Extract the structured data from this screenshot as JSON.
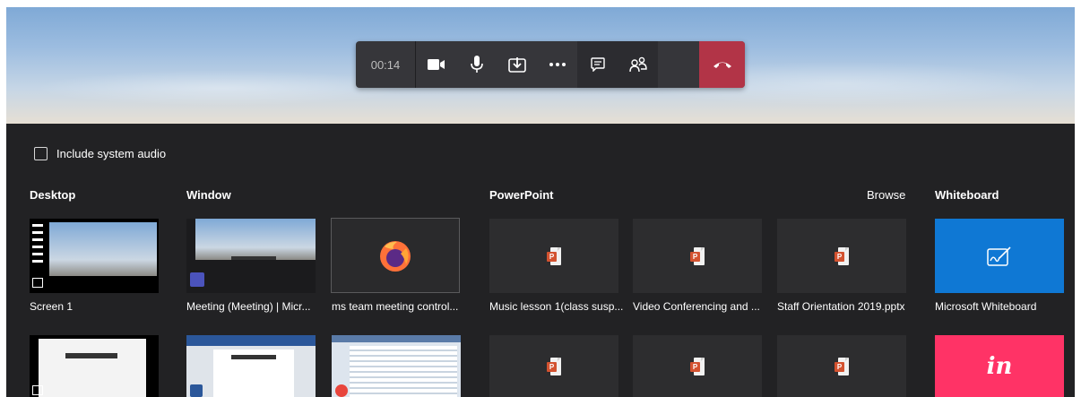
{
  "controls": {
    "timer": "00:14",
    "icons": [
      "video-camera-icon",
      "microphone-icon",
      "share-tray-icon",
      "more-options-icon",
      "chat-icon",
      "participants-icon",
      "hang-up-icon"
    ]
  },
  "tray": {
    "include_audio_label": "Include system audio",
    "sections": {
      "desktop": "Desktop",
      "window": "Window",
      "powerpoint": "PowerPoint",
      "browse": "Browse",
      "whiteboard": "Whiteboard"
    },
    "row1": {
      "screen": "Screen 1",
      "window1": "Meeting (Meeting) | Micr...",
      "window2": "ms team meeting control...",
      "ppt1": "Music lesson 1(class susp...",
      "ppt2": "Video Conferencing and ...",
      "ppt3": "Staff Orientation 2019.pptx",
      "whiteboard": "Microsoft Whiteboard"
    },
    "invision_text": "in"
  },
  "colors": {
    "tray_bg": "#222224",
    "controls_bg": "#36363a",
    "hangup": "#b23447",
    "whiteboard_blue": "#0f78d4",
    "invision_pink": "#ff3366",
    "ppt_red": "#d35230"
  }
}
